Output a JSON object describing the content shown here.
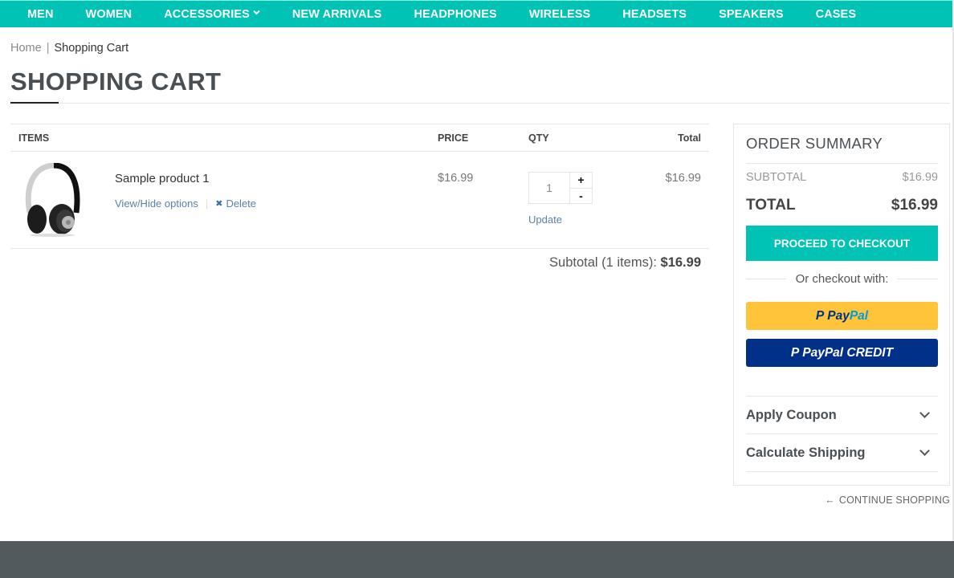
{
  "nav": {
    "items": [
      {
        "label": "MEN"
      },
      {
        "label": "WOMEN"
      },
      {
        "label": "ACCESSORIES",
        "has_dropdown": true
      },
      {
        "label": "NEW ARRIVALS"
      },
      {
        "label": "HEADPHONES"
      },
      {
        "label": "WIRELESS"
      },
      {
        "label": "HEADSETS"
      },
      {
        "label": "SPEAKERS"
      },
      {
        "label": "CASES"
      }
    ],
    "dropdown_glyph": "⌄",
    "color": "#00c2b5"
  },
  "breadcrumb": {
    "home": "Home",
    "separator": "|",
    "current": "Shopping Cart"
  },
  "page_title": "SHOPPING CART",
  "cart": {
    "headers": {
      "items": "ITEMS",
      "price": "PRICE",
      "qty": "QTY",
      "total": "Total"
    },
    "rows": [
      {
        "image_icon": "headphones-image",
        "name": "Sample product 1",
        "view_options": "View/Hide options",
        "delete_icon": "✖",
        "delete": "Delete",
        "price": "$16.99",
        "qty": "1",
        "plus": "+",
        "minus": "-",
        "update": "Update",
        "total": "$16.99"
      }
    ],
    "subtotal_label": "Subtotal (1 items):",
    "subtotal_value": "$16.99"
  },
  "summary": {
    "title": "ORDER SUMMARY",
    "subtotal_label": "SUBTOTAL",
    "subtotal_value": "$16.99",
    "total_label": "TOTAL",
    "total_value": "$16.99",
    "checkout": "PROCEED TO CHECKOUT",
    "or_checkout": "Or checkout with:",
    "paypal_pay": "Pay",
    "paypal_pal": "Pal",
    "paypal_credit": "PayPal CREDIT",
    "paypal_mark": "P",
    "accordions": [
      {
        "label": "Apply Coupon"
      },
      {
        "label": "Calculate Shipping"
      }
    ]
  },
  "continue_shopping": {
    "arrow": "←",
    "label": "CONTINUE SHOPPING"
  }
}
